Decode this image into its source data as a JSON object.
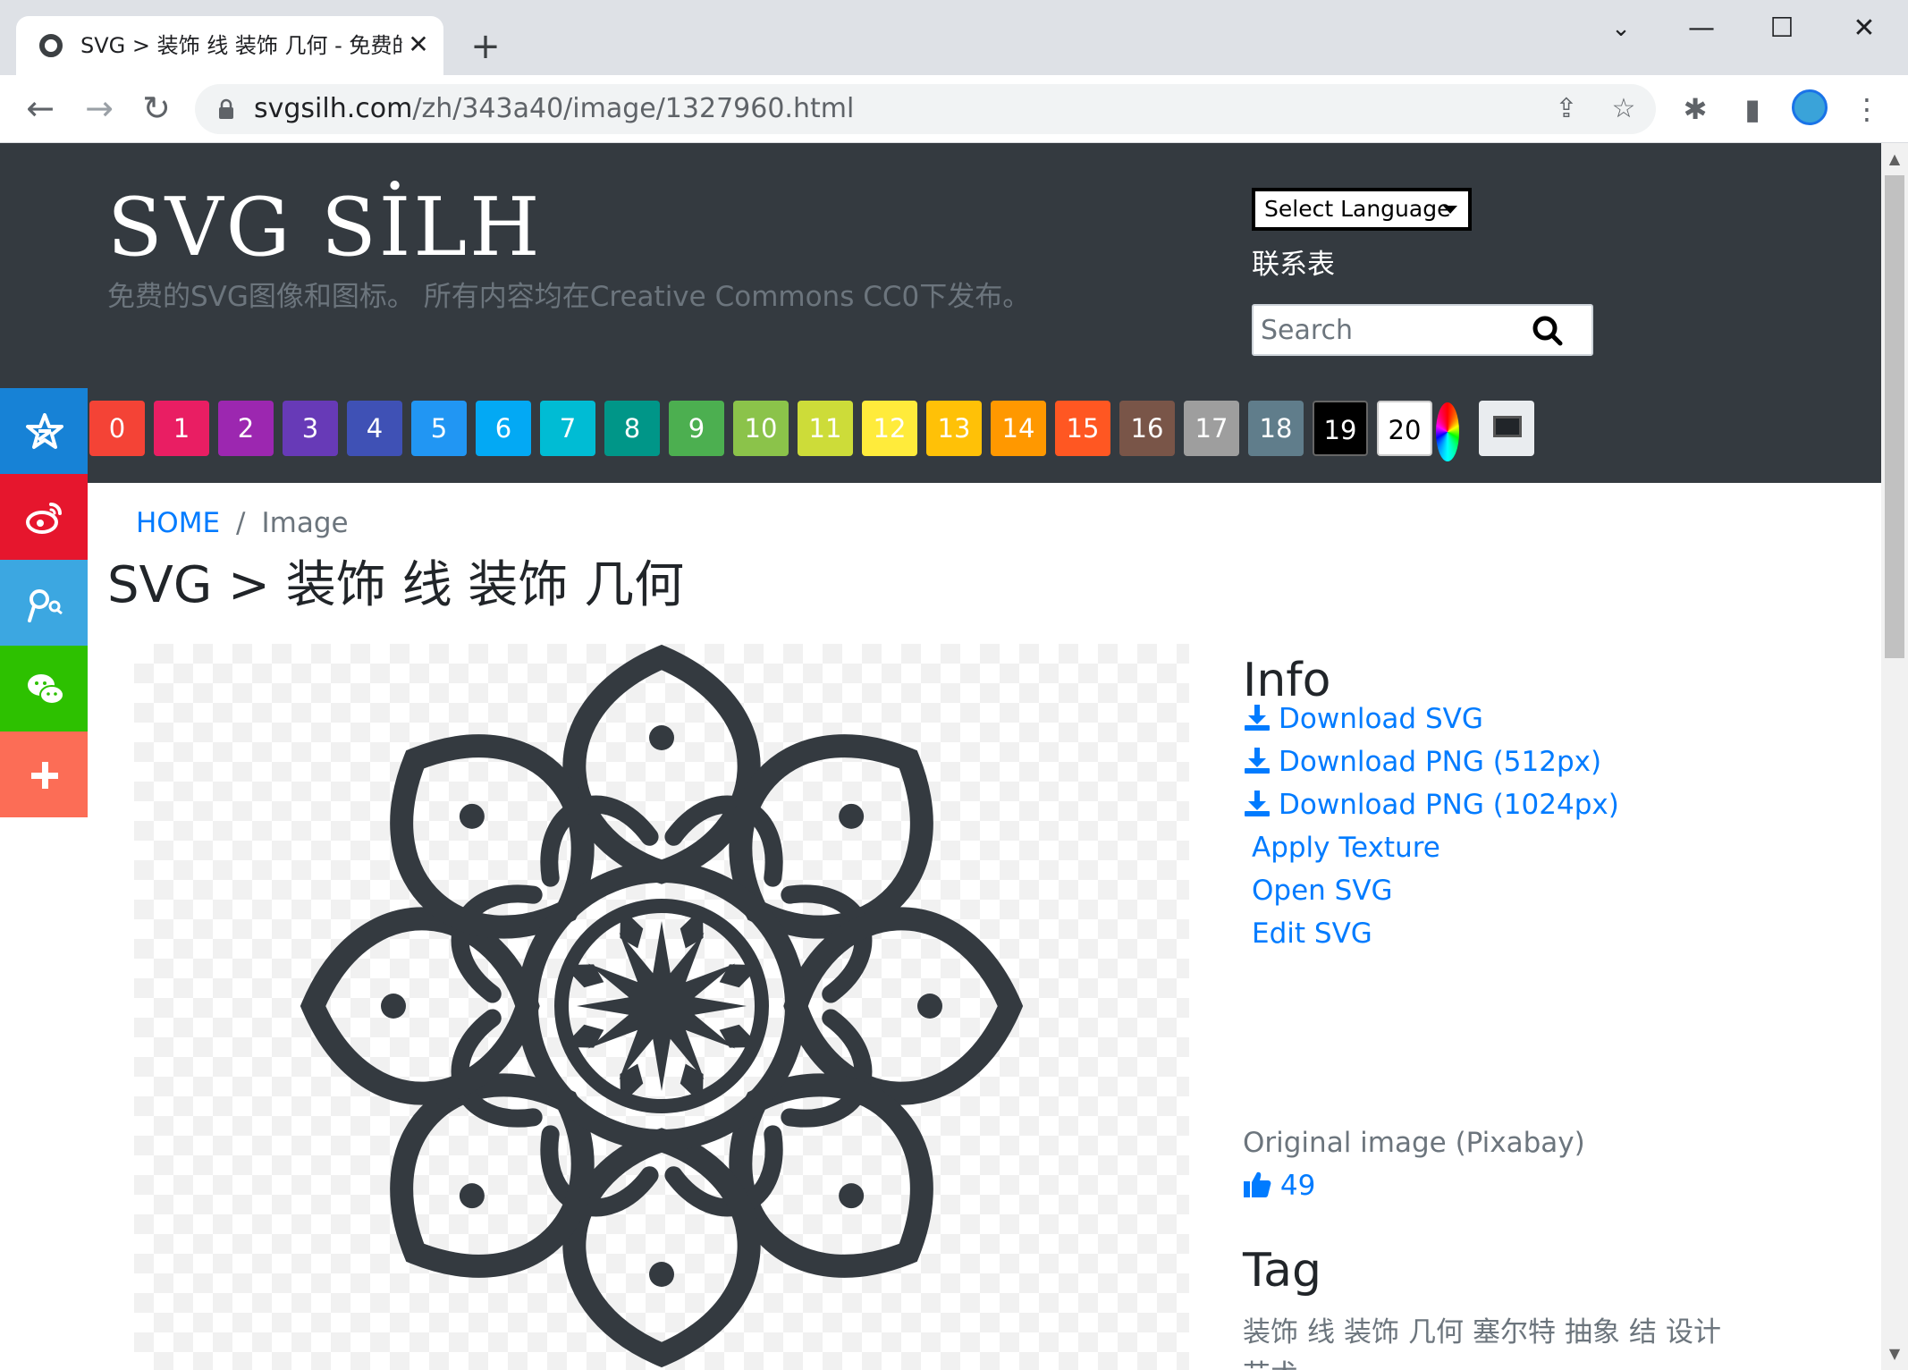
{
  "browser": {
    "tab_title": "SVG > 装饰 线 装饰 几何 - 免费的",
    "url_host": "svgsilh.com",
    "url_path": "/zh/343a40/image/1327960.html"
  },
  "header": {
    "logo": "SVG SİLH",
    "tagline": "免费的SVG图像和图标。 所有内容均在Creative Commons CC0下发布。",
    "language_select": "Select Language",
    "contact": "联系表",
    "search_placeholder": "Search"
  },
  "colors": [
    {
      "label": "0",
      "color": "#f44336"
    },
    {
      "label": "1",
      "color": "#e91e63"
    },
    {
      "label": "2",
      "color": "#9c27b0"
    },
    {
      "label": "3",
      "color": "#673ab7"
    },
    {
      "label": "4",
      "color": "#3f51b5"
    },
    {
      "label": "5",
      "color": "#2196f3"
    },
    {
      "label": "6",
      "color": "#03a9f4"
    },
    {
      "label": "7",
      "color": "#00bcd4"
    },
    {
      "label": "8",
      "color": "#009688"
    },
    {
      "label": "9",
      "color": "#4caf50"
    },
    {
      "label": "10",
      "color": "#8bc34a"
    },
    {
      "label": "11",
      "color": "#cddc39"
    },
    {
      "label": "12",
      "color": "#ffeb3b"
    },
    {
      "label": "13",
      "color": "#ffc107"
    },
    {
      "label": "14",
      "color": "#ff9800"
    },
    {
      "label": "15",
      "color": "#ff5722"
    },
    {
      "label": "16",
      "color": "#795548"
    },
    {
      "label": "17",
      "color": "#9e9e9e"
    },
    {
      "label": "18",
      "color": "#607d8b"
    },
    {
      "label": "19",
      "color": "#000000"
    },
    {
      "label": "20",
      "color": "#ffffff"
    }
  ],
  "share": [
    {
      "name": "qzone-icon",
      "color": "#1782d6"
    },
    {
      "name": "weibo-icon",
      "color": "#e6162d"
    },
    {
      "name": "tencent-weibo-icon",
      "color": "#3ca7e1"
    },
    {
      "name": "wechat-icon",
      "color": "#2dc100"
    },
    {
      "name": "plus-icon",
      "color": "#fc6d56"
    }
  ],
  "breadcrumb": {
    "home": "HOME",
    "separator": "/",
    "current": "Image"
  },
  "page_title": "SVG > 装饰 线 装饰 几何",
  "info": {
    "heading": "Info",
    "download_svg": "Download SVG",
    "download_png_512": "Download PNG (512px)",
    "download_png_1024": "Download PNG (1024px)",
    "apply_texture": "Apply Texture",
    "open_svg": "Open SVG",
    "edit_svg": "Edit SVG",
    "original": "Original image (Pixabay)",
    "likes": "49"
  },
  "tag": {
    "heading": "Tag",
    "tags": [
      "装饰",
      "线",
      "装饰",
      "几何",
      "塞尔特",
      "抽象",
      "结",
      "设计",
      "艺术"
    ]
  },
  "theme": {
    "header_bg": "#343a40",
    "link": "#007bff",
    "ornament": "#343a40"
  }
}
